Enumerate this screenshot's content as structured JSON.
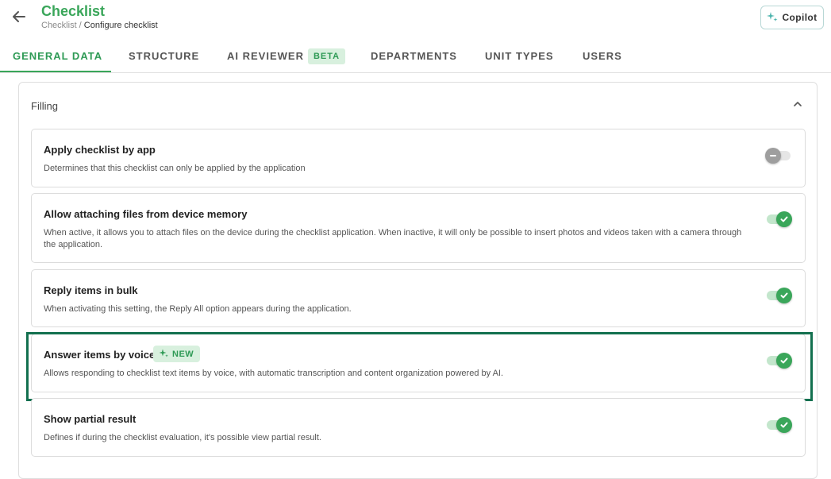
{
  "header": {
    "title": "Checklist",
    "breadcrumb_parent": "Checklist",
    "breadcrumb_separator": " / ",
    "breadcrumb_current": "Configure checklist",
    "copilot_label": "Copilot"
  },
  "tabs": [
    {
      "label": "GENERAL DATA",
      "active": true
    },
    {
      "label": "STRUCTURE"
    },
    {
      "label": "AI REVIEWER",
      "badge": "BETA"
    },
    {
      "label": "DEPARTMENTS"
    },
    {
      "label": "UNIT TYPES"
    },
    {
      "label": "USERS"
    }
  ],
  "section": {
    "title": "Filling",
    "expanded": true
  },
  "settings": [
    {
      "title": "Apply checklist by app",
      "description": "Determines that this checklist can only be applied by the application",
      "enabled": false
    },
    {
      "title": "Allow attaching files from device memory",
      "description": "When active, it allows you to attach files on the device during the checklist application. When inactive, it will only be possible to insert photos and videos taken with a camera through the application.",
      "enabled": true
    },
    {
      "title": "Reply items in bulk",
      "description": "When activating this setting, the Reply All option appears during the application.",
      "enabled": true
    },
    {
      "title": "Answer items by voice",
      "badge": "NEW",
      "description": "Allows responding to checklist text items by voice, with automatic transcription and content organization powered by AI.",
      "enabled": true,
      "highlighted": true
    },
    {
      "title": "Show partial result",
      "description": "Defines if during the checklist evaluation, it's possible view partial result.",
      "enabled": true
    }
  ],
  "colors": {
    "accent": "#3aa65a",
    "highlight_border": "#13704f",
    "badge_bg": "#d8f0de"
  },
  "icons": {
    "back": "arrow-left-icon",
    "copilot": "sparkle-icon",
    "collapse": "chevron-up-icon",
    "toggle_on": "check-icon",
    "toggle_off": "minus-icon",
    "new_badge": "sparkle-icon"
  }
}
